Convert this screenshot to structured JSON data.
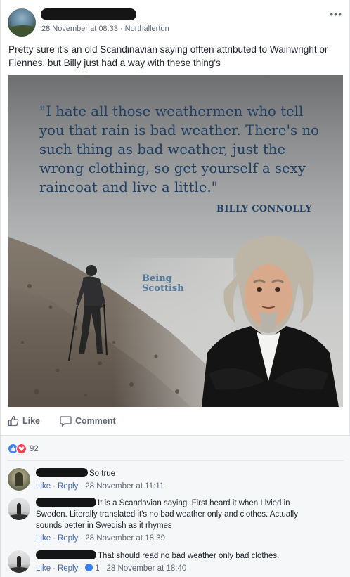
{
  "post": {
    "timestamp": "28 November at 08:33",
    "location": "Northallerton",
    "separator": "·",
    "more_label": "•••",
    "text": "Pretty sure it's an old Scandinavian saying offten attributed to Wainwright or Fiennes, but Billy just had a way with these thing's"
  },
  "image": {
    "quote": "\"I hate all those weathermen who tell you that rain is bad weather. There's no such thing as bad weather, just the wrong clothing, so get yourself a sexy raincoat and live a little.\"",
    "attribution": "BILLY CONNOLLY",
    "watermark_line1": "Being",
    "watermark_line2": "Scottish"
  },
  "actions": {
    "like_label": "Like",
    "comment_label": "Comment"
  },
  "reactions": {
    "count": "92",
    "colors": {
      "like": "#3b82f0",
      "love": "#f33e58"
    }
  },
  "comments": [
    {
      "text": "So true",
      "like": "Like",
      "reply": "Reply",
      "time": "28 November at 11:11"
    },
    {
      "text": "It is a Scandavian saying. First heard it when I lvied in Sweden. Literally translated it's no bad weather only and clothes. Actually sounds better in Swedish as it rhymes",
      "like": "Like",
      "reply": "Reply",
      "time": "28 November at 18:39"
    },
    {
      "text": "That should read no bad weather only bad clothes.",
      "like": "Like",
      "reply": "Reply",
      "like_count": "1",
      "time": "28 November at 18:40"
    }
  ],
  "colors": {
    "link": "#4267b2",
    "meta": "#606770",
    "quote_text": "#1f3f63"
  }
}
